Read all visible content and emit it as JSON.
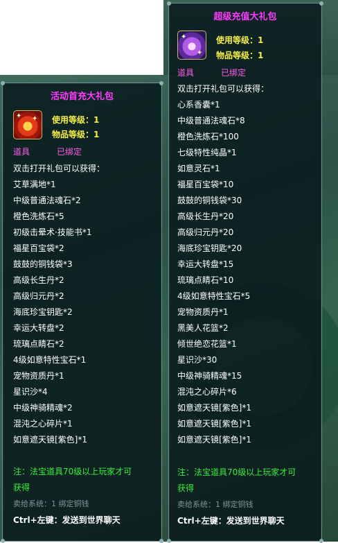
{
  "left_tooltip": {
    "title": "活动首充大礼包",
    "use_level": "使用等级：1",
    "item_level": "物品等级：1",
    "type": "道具",
    "bound": "已绑定",
    "open_hint": "双击打开礼包可以获得：",
    "items": [
      "艾草满地*1",
      "中级普通法魂石*2",
      "橙色洗炼石*5",
      "初级击晕术·技能书*1",
      "福星百宝袋*2",
      "鼓鼓的铜钱袋*3",
      "高级长生丹*2",
      "高级归元丹*2",
      "海底珍宝钥匙*2",
      "幸运大转盘*2",
      "琉璃点睛石*2",
      "4级如意特性宝石*1",
      "宠物资质丹*1",
      "星识沙*4",
      "中级神骑精魂*2",
      "混沌之心碎片*1",
      "如意遮天镜[紫色]*1"
    ],
    "note_line1": "注：法宝道具70级以上玩家才可",
    "note_line2": "获得",
    "sell_info": "卖给系统：1 绑定铜钱",
    "send_hint": "Ctrl+左键：发送到世界聊天"
  },
  "right_tooltip": {
    "title": "超级充值大礼包",
    "use_level": "使用等级：1",
    "item_level": "物品等级：1",
    "type": "道具",
    "bound": "已绑定",
    "open_hint": "双击打开礼包可以获得：",
    "items": [
      "心系香囊*1",
      "中级普通法魂石*8",
      "橙色洗炼石*100",
      "七级特性纯晶*1",
      "如意灵石*1",
      "福星百宝袋*10",
      "鼓鼓的铜钱袋*30",
      "高级长生丹*20",
      "高级归元丹*20",
      "海底珍宝钥匙*20",
      "幸运大转盘*15",
      "琉璃点睛石*10",
      "4级如意特性宝石*5",
      "宠物资质丹*1",
      "黑美人花篮*2",
      "倾世绝恋花篮*1",
      "星识沙*30",
      "中级神骑精魂*15",
      "混沌之心碎片*6",
      "如意遮天镜[紫色]*1",
      "如意遮天镜[紫色]*1",
      "如意遮天镜[紫色]*1"
    ],
    "note_line1": "注：法宝道具70级以上玩家才可",
    "note_line2": "获得",
    "sell_info": "卖给系统：1 绑定铜钱",
    "send_hint": "Ctrl+左键：发送到世界聊天"
  }
}
